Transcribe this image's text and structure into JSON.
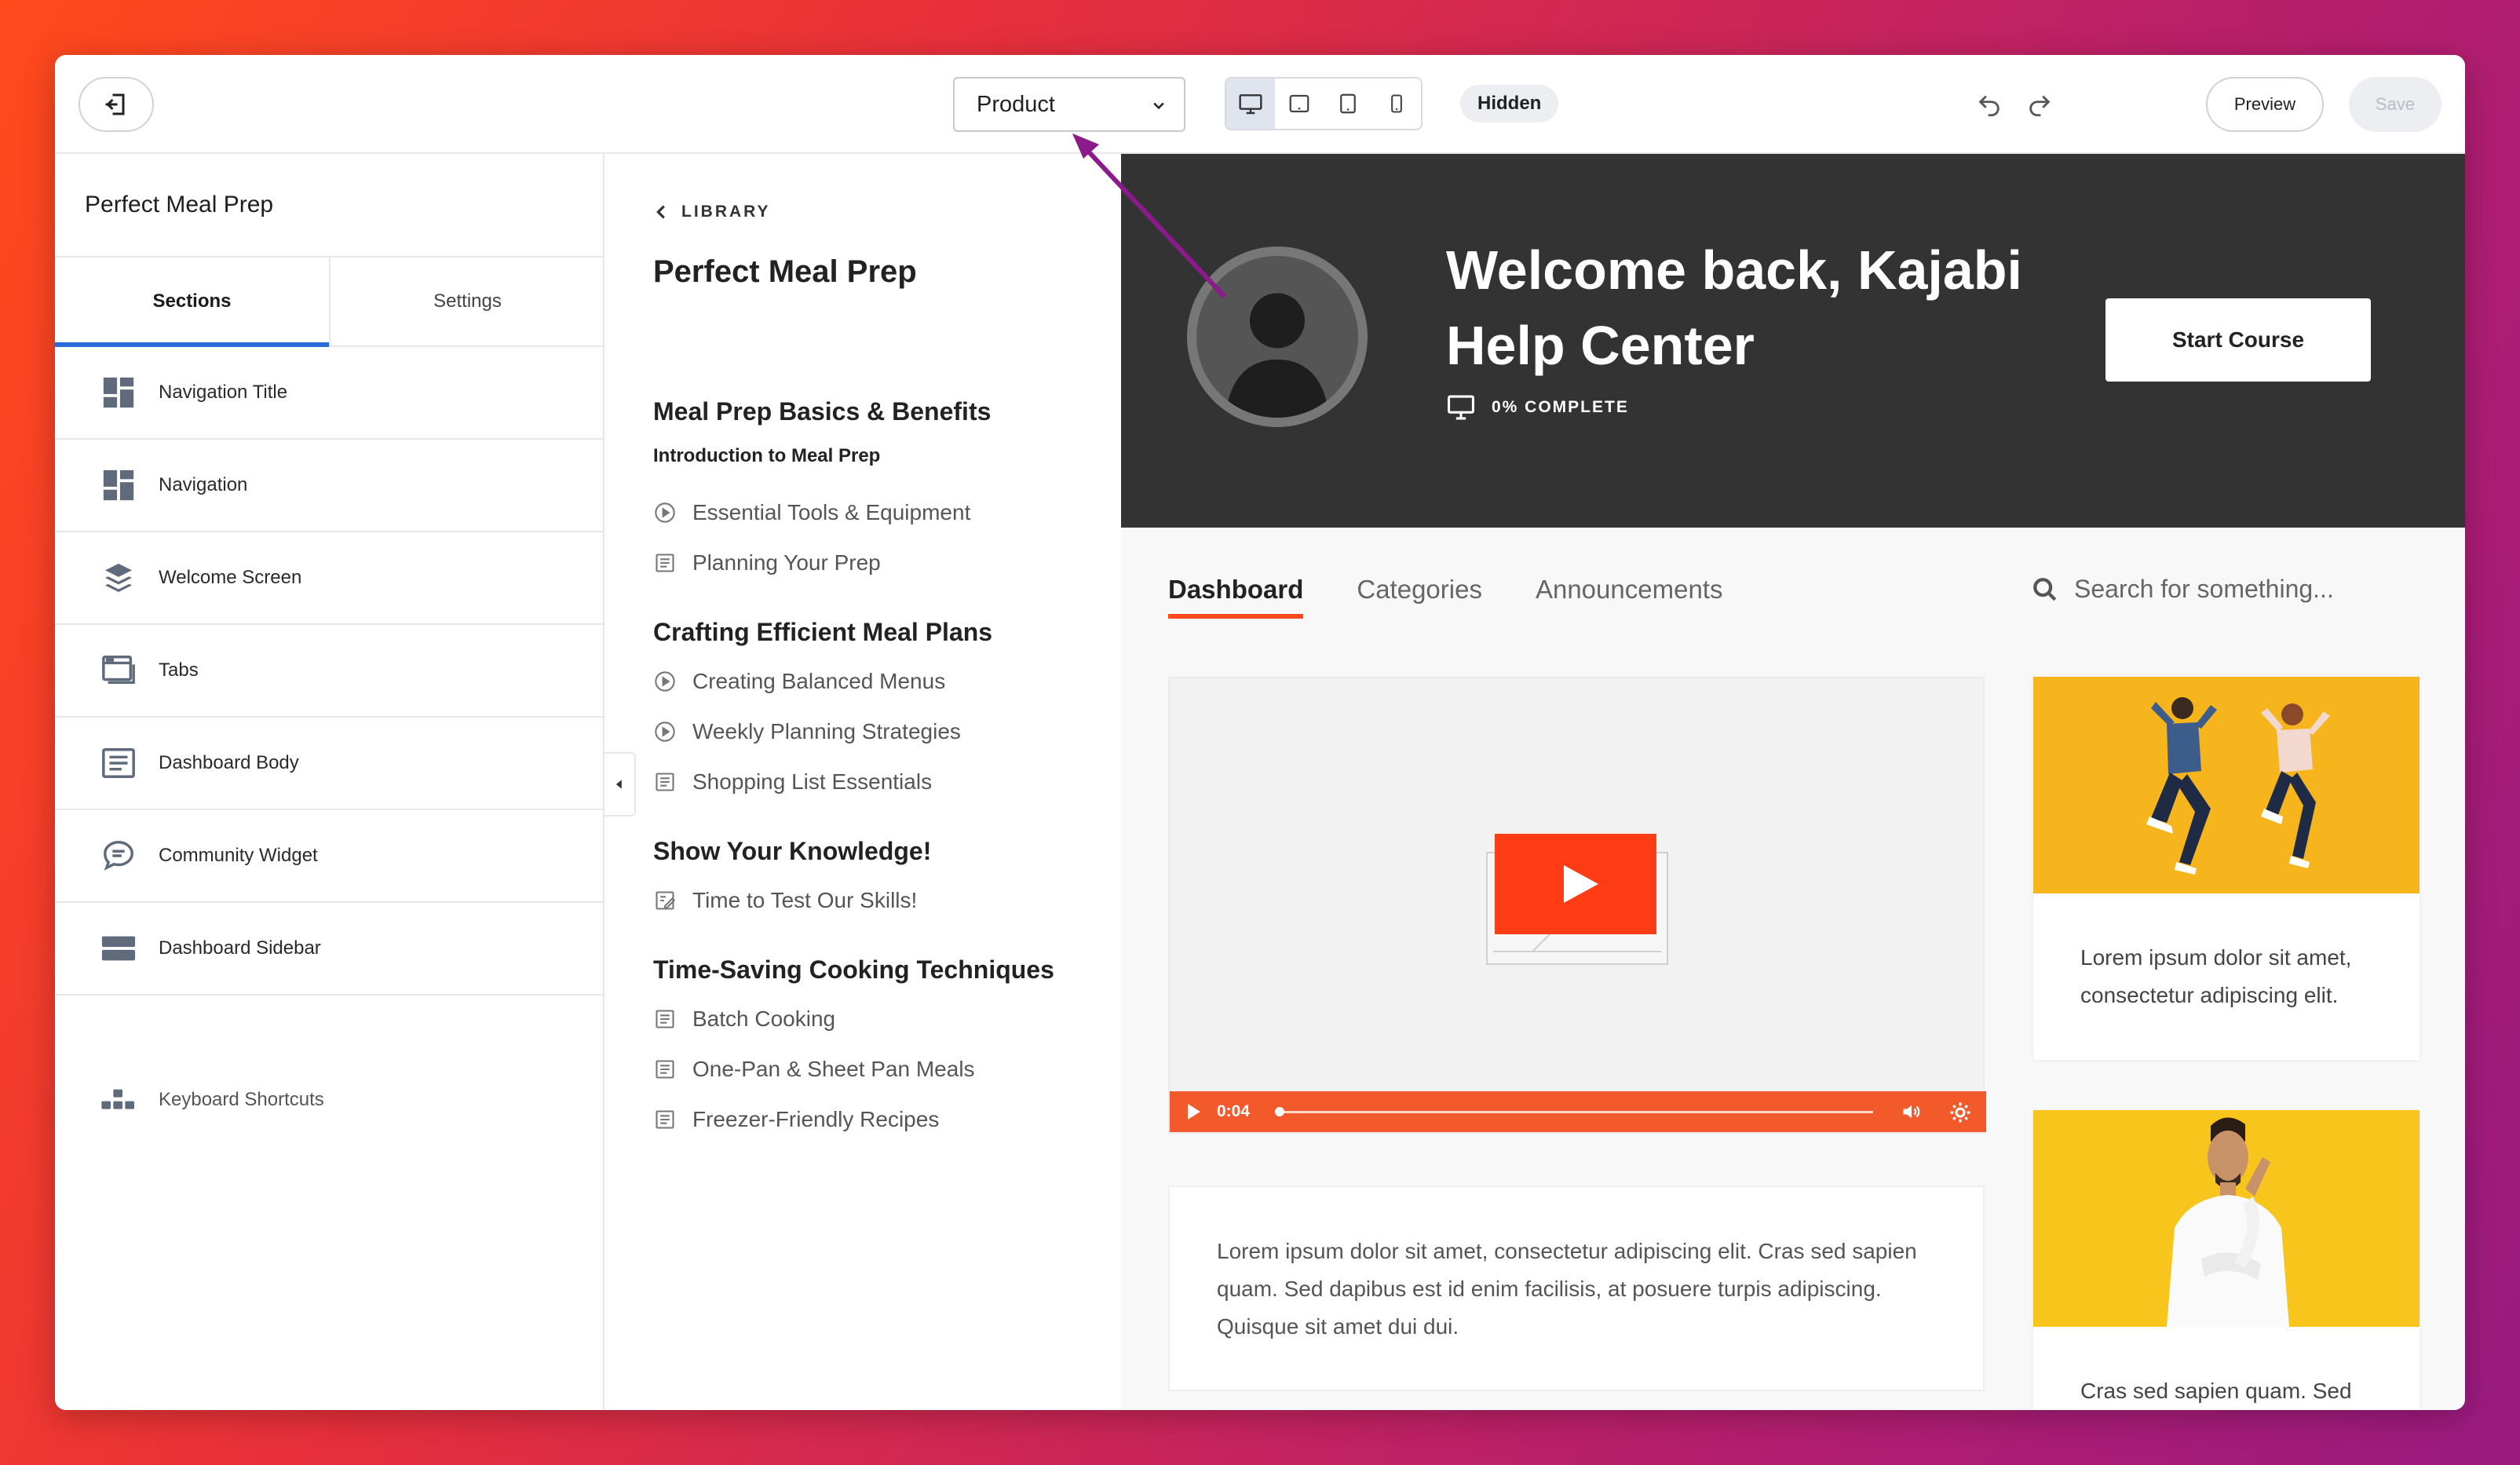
{
  "topbar": {
    "exit_icon": "exit-icon",
    "select_value": "Product",
    "devices": [
      "desktop-icon",
      "tablet-landscape-icon",
      "tablet-portrait-icon",
      "mobile-icon"
    ],
    "hidden_label": "Hidden",
    "preview_label": "Preview",
    "save_label": "Save"
  },
  "sidebar": {
    "title": "Perfect Meal Prep",
    "tabs": [
      {
        "label": "Sections"
      },
      {
        "label": "Settings"
      }
    ],
    "items": [
      {
        "label": "Navigation Title",
        "icon": "layout-icon"
      },
      {
        "label": "Navigation",
        "icon": "layout-icon"
      },
      {
        "label": "Welcome Screen",
        "icon": "layers-icon"
      },
      {
        "label": "Tabs",
        "icon": "browser-tabs-icon"
      },
      {
        "label": "Dashboard Body",
        "icon": "document-icon"
      },
      {
        "label": "Community Widget",
        "icon": "chat-icon"
      },
      {
        "label": "Dashboard Sidebar",
        "icon": "sidebar-icon"
      }
    ],
    "shortcuts_label": "Keyboard Shortcuts"
  },
  "library": {
    "back_label": "LIBRARY",
    "title": "Perfect Meal Prep",
    "modules": [
      {
        "title": "Meal Prep Basics & Benefits"
      },
      {
        "title": "Crafting Efficient Meal Plans"
      },
      {
        "title": "Show Your Knowledge!"
      },
      {
        "title": "Time-Saving Cooking Techniques"
      }
    ],
    "submodule": "Introduction to Meal Prep",
    "lessons": [
      {
        "label": "Essential Tools & Equipment",
        "icon": "play-circle-icon"
      },
      {
        "label": "Planning Your Prep",
        "icon": "text-doc-icon"
      },
      {
        "label": "Creating Balanced Menus",
        "icon": "play-circle-icon"
      },
      {
        "label": "Weekly Planning Strategies",
        "icon": "play-circle-icon"
      },
      {
        "label": "Shopping List Essentials",
        "icon": "text-doc-icon"
      },
      {
        "label": "Time to Test Our Skills!",
        "icon": "quiz-icon"
      },
      {
        "label": "Batch Cooking",
        "icon": "text-doc-icon"
      },
      {
        "label": "One-Pan & Sheet Pan Meals",
        "icon": "text-doc-icon"
      },
      {
        "label": "Freezer-Friendly Recipes",
        "icon": "text-doc-icon"
      }
    ]
  },
  "hero": {
    "title": "Welcome back, Kajabi Help Center",
    "progress": "0% COMPLETE",
    "start_label": "Start Course"
  },
  "tabs": [
    {
      "label": "Dashboard"
    },
    {
      "label": "Categories"
    },
    {
      "label": "Announcements"
    }
  ],
  "search": {
    "placeholder": "Search for something..."
  },
  "video": {
    "time": "0:04",
    "progress": 0
  },
  "body_text": "Lorem ipsum dolor sit amet, consectetur adipiscing elit. Cras sed sapien quam. Sed dapibus est id enim facilisis, at posuere turpis adipiscing. Quisque sit amet dui dui.",
  "side_cards": [
    {
      "text": "Lorem ipsum dolor sit amet, consectetur adipiscing elit."
    },
    {
      "text": "Cras sed sapien quam. Sed"
    }
  ],
  "colors": {
    "accent": "#ff4a1c",
    "hero_bg": "#333333",
    "tab_active": "#2a6ad8",
    "annotation_arrow": "#8b1a8b"
  }
}
